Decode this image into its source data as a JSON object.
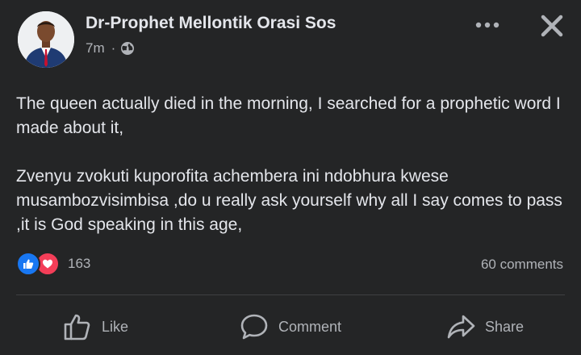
{
  "post": {
    "author": "Dr-Prophet Mellontik Orasi Sos",
    "time": "7m",
    "separator": "·",
    "audience_icon": "globe-icon",
    "paragraphs": [
      "The queen actually died in the morning, I searched for a prophetic word I made about it,",
      "Zvenyu zvokuti kuporofita achembera ini ndobhura kwese musambozvisimbisa ,do u really ask yourself why all I say comes to pass ,it is God speaking in this age,"
    ]
  },
  "reactions": {
    "icons": [
      "like-reaction-icon",
      "love-reaction-icon"
    ],
    "count": "163",
    "comments": "60 comments"
  },
  "actions": {
    "like": "Like",
    "comment": "Comment",
    "share": "Share"
  },
  "colors": {
    "background": "#242526",
    "text": "#e4e6eb",
    "secondary": "#b0b3b8",
    "like_blue": "#1877f2",
    "love_red": "#f33e58"
  }
}
